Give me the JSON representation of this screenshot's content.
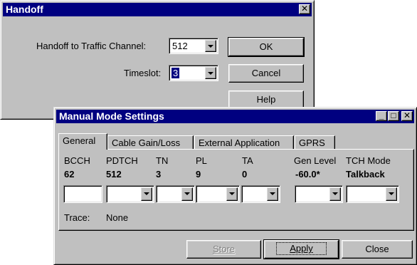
{
  "handoff": {
    "title": "Handoff",
    "channel_label": "Handoff to Traffic Channel:",
    "channel_value": "512",
    "timeslot_label": "Timeslot:",
    "timeslot_value": "3",
    "ok": "OK",
    "cancel": "Cancel",
    "help": "Help",
    "close_glyph": "✕"
  },
  "manual": {
    "title": "Manual Mode Settings",
    "minimize_glyph": "_",
    "maximize_glyph": "□",
    "close_glyph": "✕",
    "tabs": [
      "General",
      "Cable Gain/Loss",
      "External Application",
      "GPRS"
    ],
    "fields": {
      "bcch": {
        "label": "BCCH",
        "value": "62"
      },
      "pdtch": {
        "label": "PDTCH",
        "value": "512"
      },
      "tn": {
        "label": "TN",
        "value": "3"
      },
      "pl": {
        "label": "PL",
        "value": "9"
      },
      "ta": {
        "label": "TA",
        "value": "0"
      },
      "gen_level": {
        "label": "Gen Level",
        "value": "-60.0*"
      },
      "tch_mode": {
        "label": "TCH Mode",
        "value": "Talkback"
      }
    },
    "trace_label": "Trace:",
    "trace_value": "None",
    "store": "Store",
    "apply": "Apply",
    "close": "Close"
  }
}
